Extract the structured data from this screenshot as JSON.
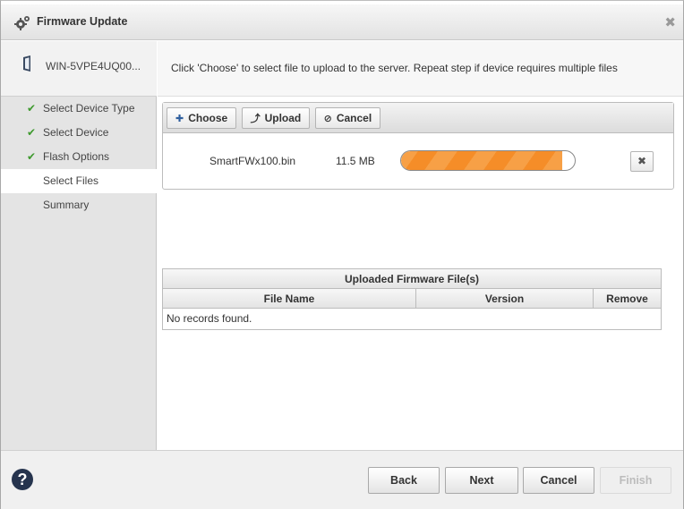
{
  "window": {
    "title": "Firmware Update",
    "close_glyph": "✖"
  },
  "device": {
    "name": "WIN-5VPE4UQ00..."
  },
  "steps": [
    {
      "label": "Select Device Type",
      "done": true
    },
    {
      "label": "Select Device",
      "done": true
    },
    {
      "label": "Flash Options",
      "done": true
    },
    {
      "label": "Select Files",
      "active": true
    },
    {
      "label": "Summary"
    }
  ],
  "instruction": "Click 'Choose' to select file to upload to the server. Repeat step if device requires multiple files",
  "uploader": {
    "buttons": [
      {
        "label": "Choose",
        "icon": "plus-icon"
      },
      {
        "label": "Upload",
        "icon": "upload-arrow-icon"
      },
      {
        "label": "Cancel",
        "icon": "cancel-circle-icon"
      }
    ],
    "file": {
      "name": "SmartFWx100.bin",
      "size": "11.5 MB",
      "progress": 0.93
    },
    "remove_glyph": "✖"
  },
  "uploaded_table": {
    "caption": "Uploaded Firmware File(s)",
    "columns": [
      "File Name",
      "Version",
      "Remove"
    ],
    "empty_message": "No records found."
  },
  "footer": {
    "help_glyph": "?",
    "back": "Back",
    "next": "Next",
    "cancel": "Cancel",
    "finish": "Finish"
  }
}
